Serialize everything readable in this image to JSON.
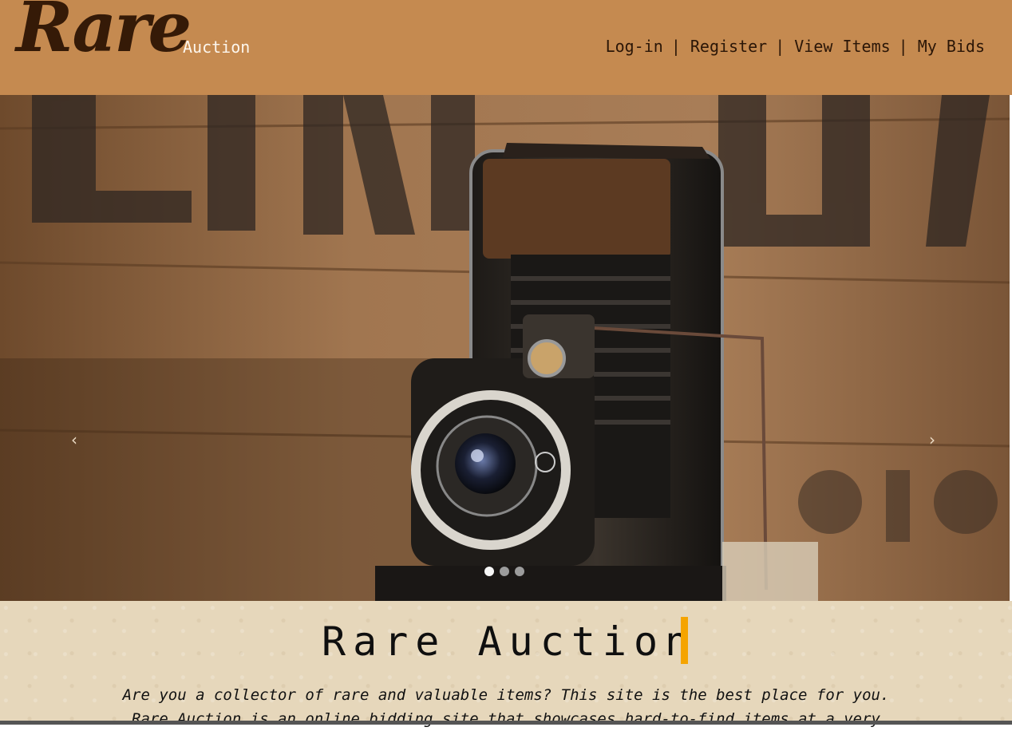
{
  "header": {
    "logo": "Rare",
    "subtitle": "Auction",
    "nav": [
      {
        "label": "Log-in"
      },
      {
        "label": "Register"
      },
      {
        "label": "View Items"
      },
      {
        "label": "My Bids"
      }
    ],
    "separator": "|"
  },
  "hero": {
    "arrows": {
      "prev": "‹",
      "next": "›"
    },
    "slide_count": 3,
    "active_slide": 1,
    "icons": [
      "chevron-left-icon",
      "chevron-right-icon"
    ]
  },
  "intro": {
    "title": "Rare Auction",
    "text_line1": "Are you a collector of rare and valuable items? This site is the best place for you.",
    "text_line2": "Rare Auction is an online bidding site that showcases hard-to-find items at a very"
  },
  "colors": {
    "header_bg": "#c58a50",
    "logo": "#351a07",
    "cursor": "#f5a400",
    "intro_bg": "#e6d7bb"
  }
}
